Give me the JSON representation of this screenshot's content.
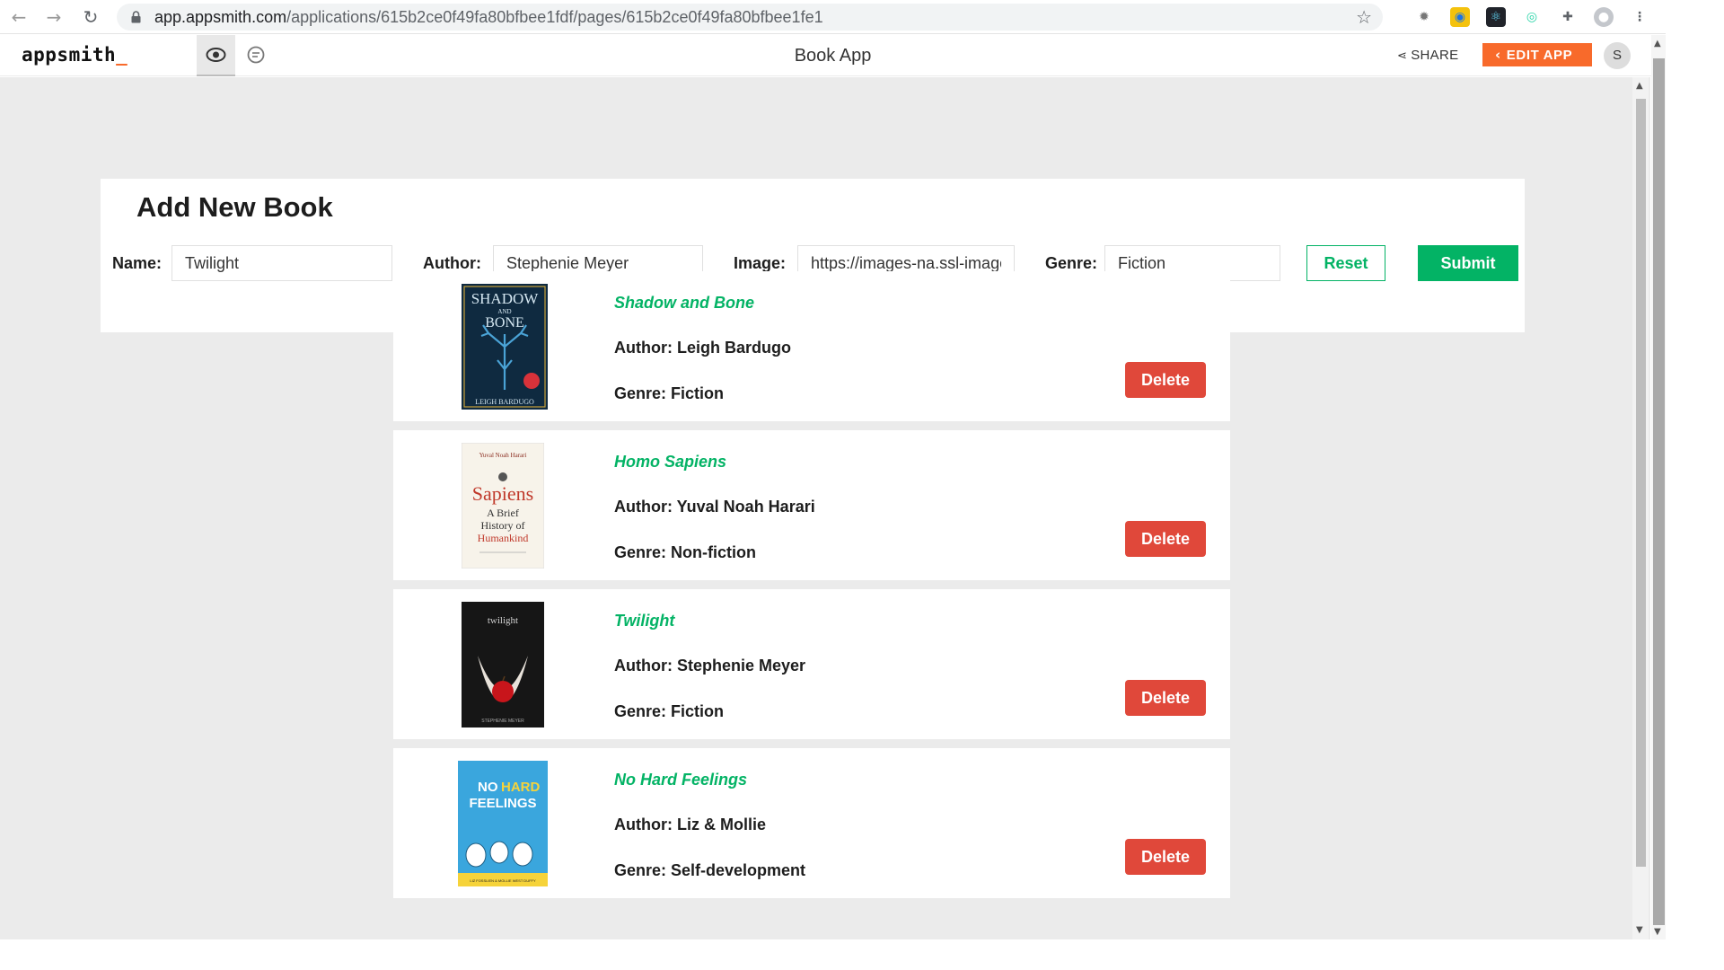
{
  "browser": {
    "url_host": "app.appsmith.com",
    "url_path": "/applications/615b2ce0f49fa80bfbee1fdf/pages/615b2ce0f49fa80bfbee1fe1"
  },
  "header": {
    "logo": "appsmith",
    "logo_cursor": "_",
    "app_title": "Book App",
    "share_label": "SHARE",
    "edit_label": "EDIT APP",
    "avatar_initial": "S"
  },
  "colors": {
    "accent_green": "#03b365",
    "delete_red": "#e0483a",
    "edit_orange": "#f86a2b"
  },
  "form": {
    "title": "Add New Book",
    "name_label": "Name:",
    "name_value": "Twilight",
    "author_label": "Author:",
    "author_value": "Stephenie Meyer",
    "image_label": "Image:",
    "image_value": "https://images-na.ssl-images-amazon.com",
    "genre_label": "Genre:",
    "genre_value": "Fiction",
    "reset_label": "Reset",
    "submit_label": "Submit"
  },
  "books": [
    {
      "title": "Shadow and Bone",
      "author": "Author: Leigh Bardugo",
      "genre": "Genre: Fiction",
      "delete_label": "Delete",
      "cover": {
        "line1": "SHADOW",
        "line2": "AND",
        "line3": "BONE",
        "footer": "LEIGH BARDUGO"
      }
    },
    {
      "title": "Homo Sapiens",
      "author": "Author: Yuval Noah Harari",
      "genre": "Genre: Non-fiction",
      "delete_label": "Delete",
      "cover": {
        "line1": "Yuval Noah Harari",
        "line2": "Sapiens",
        "line3": "A Brief",
        "line4": "History of",
        "line5": "Humankind"
      }
    },
    {
      "title": "Twilight",
      "author": "Author: Stephenie Meyer",
      "genre": "Genre: Fiction",
      "delete_label": "Delete",
      "cover": {
        "line1": "twilight",
        "footer": "STEPHENIE MEYER"
      }
    },
    {
      "title": "No Hard Feelings",
      "author": "Author: Liz & Mollie",
      "genre": "Genre: Self-development",
      "delete_label": "Delete",
      "cover": {
        "line1": "NO",
        "line2": "HARD",
        "line3": "FEELINGS",
        "footer": "LIZ FOSSLIEN & MOLLIE WEST DUFFY"
      }
    }
  ]
}
